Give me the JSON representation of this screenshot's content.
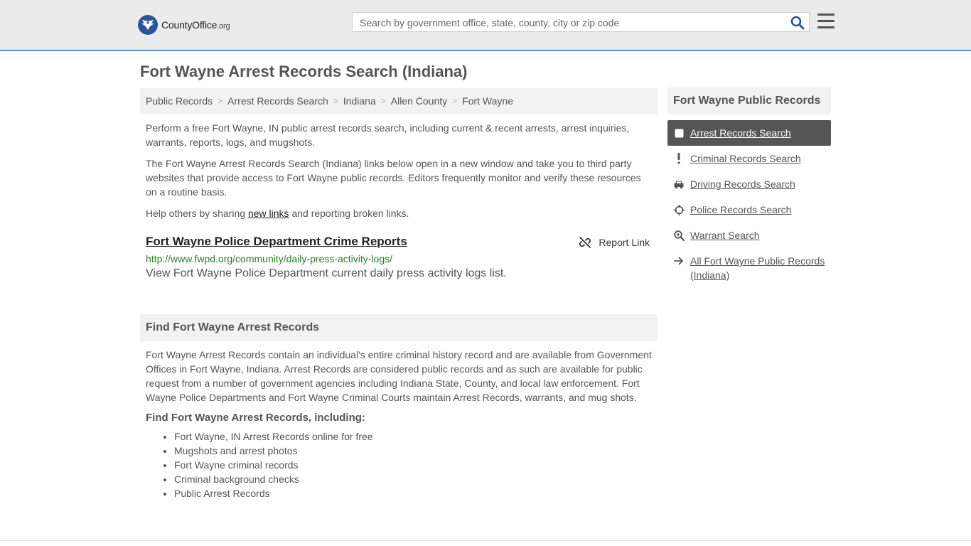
{
  "header": {
    "logo_brand": "CountyOffice",
    "logo_tld": ".org",
    "search_placeholder": "Search by government office, state, county, city or zip code",
    "search_icon": "search-icon",
    "menu_icon": "hamburger-menu-icon"
  },
  "page": {
    "title": "Fort Wayne Arrest Records Search (Indiana)"
  },
  "breadcrumb": [
    "Public Records",
    "Arrest Records Search",
    "Indiana",
    "Allen County",
    "Fort Wayne"
  ],
  "intro": {
    "p1": "Perform a free Fort Wayne, IN public arrest records search, including current & recent arrests, arrest inquiries, warrants, reports, logs, and mugshots.",
    "p2": "The Fort Wayne Arrest Records Search (Indiana) links below open in a new window and take you to third party websites that provide access to Fort Wayne public records. Editors frequently monitor and verify these resources on a routine basis.",
    "p3_before": "Help others by sharing ",
    "p3_link": "new links",
    "p3_after": " and reporting broken links."
  },
  "resource": {
    "title": "Fort Wayne Police Department Crime Reports",
    "report_label": "Report Link",
    "url": "http://www.fwpd.org/community/daily-press-activity-logs/",
    "description": "View Fort Wayne Police Department current daily press activity logs list."
  },
  "find_section": {
    "heading": "Find Fort Wayne Arrest Records",
    "body": "Fort Wayne Arrest Records contain an individual's entire criminal history record and are available from Government Offices in Fort Wayne, Indiana. Arrest Records are considered public records and as such are available for public request from a number of government agencies including Indiana State, County, and local law enforcement. Fort Wayne Police Departments and Fort Wayne Criminal Courts maintain Arrest Records, warrants, and mug shots.",
    "subheading": "Find Fort Wayne Arrest Records, including:",
    "items": [
      "Fort Wayne, IN Arrest Records online for free",
      "Mugshots and arrest photos",
      "Fort Wayne criminal records",
      "Criminal background checks",
      "Public Arrest Records"
    ]
  },
  "sidebar": {
    "title": "Fort Wayne Public Records",
    "items": [
      {
        "label": "Arrest Records Search",
        "icon": "square-icon",
        "active": true
      },
      {
        "label": "Criminal Records Search",
        "icon": "exclamation-icon",
        "active": false
      },
      {
        "label": "Driving Records Search",
        "icon": "car-icon",
        "active": false
      },
      {
        "label": "Police Records Search",
        "icon": "crosshairs-icon",
        "active": false
      },
      {
        "label": "Warrant Search",
        "icon": "magnify-plus-icon",
        "active": false
      },
      {
        "label": "All Fort Wayne Public Records (Indiana)",
        "icon": "arrow-right-icon",
        "active": false
      }
    ]
  },
  "colors": {
    "header_bg": "#ebebeb",
    "header_border": "#5a92c6",
    "active_nav_bg": "#555555",
    "url_green": "#2f7a2f",
    "logo_blue": "#2a5597"
  }
}
